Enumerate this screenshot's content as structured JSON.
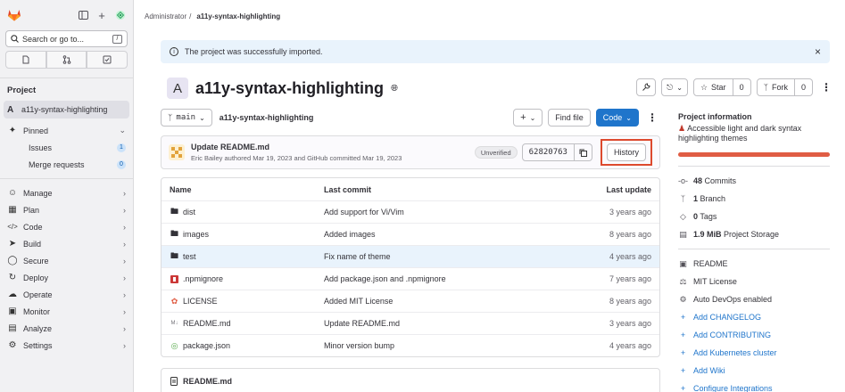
{
  "sidebar": {
    "search_label": "Search or go to...",
    "search_kbd": "/",
    "section_title": "Project",
    "project_avatar": "A",
    "project_name": "a11y-syntax-highlighting",
    "pinned": {
      "label": "Pinned",
      "items": [
        {
          "label": "Issues",
          "count": "1"
        },
        {
          "label": "Merge requests",
          "count": "0"
        }
      ]
    },
    "nav": [
      {
        "label": "Manage",
        "icon": "users-icon"
      },
      {
        "label": "Plan",
        "icon": "calendar-icon"
      },
      {
        "label": "Code",
        "icon": "code-icon"
      },
      {
        "label": "Build",
        "icon": "rocket-icon"
      },
      {
        "label": "Secure",
        "icon": "shield-icon"
      },
      {
        "label": "Deploy",
        "icon": "deploy-icon"
      },
      {
        "label": "Operate",
        "icon": "cloud-icon"
      },
      {
        "label": "Monitor",
        "icon": "monitor-icon"
      },
      {
        "label": "Analyze",
        "icon": "chart-icon"
      },
      {
        "label": "Settings",
        "icon": "gear-icon"
      }
    ]
  },
  "breadcrumb": {
    "parent": "Administrator",
    "separator": "/",
    "current": "a11y-syntax-highlighting"
  },
  "alert": {
    "message": "The project was successfully imported."
  },
  "project": {
    "avatar": "A",
    "title": "a11y-syntax-highlighting",
    "star_label": "Star",
    "star_count": "0",
    "fork_label": "Fork",
    "fork_count": "0"
  },
  "branch_bar": {
    "branch": "main",
    "path": "a11y-syntax-highlighting",
    "plus_label": "+",
    "find_file": "Find file",
    "code_label": "Code"
  },
  "last_commit": {
    "title": "Update README.md",
    "meta": "Eric Bailey authored Mar 19, 2023 and GitHub committed Mar 19, 2023",
    "status": "Unverified",
    "sha": "62820763",
    "history_label": "History"
  },
  "files": {
    "headers": {
      "name": "Name",
      "commit": "Last commit",
      "update": "Last update"
    },
    "rows": [
      {
        "name": "dist",
        "icon": "folder-icon",
        "commit": "Add support for Vi/Vim",
        "update": "3 years ago"
      },
      {
        "name": "images",
        "icon": "folder-icon",
        "commit": "Added images",
        "update": "8 years ago"
      },
      {
        "name": "test",
        "icon": "folder-icon",
        "commit": "Fix name of theme",
        "update": "4 years ago"
      },
      {
        "name": ".npmignore",
        "icon": "npm-icon",
        "commit": "Add package.json and .npmignore",
        "update": "7 years ago"
      },
      {
        "name": "LICENSE",
        "icon": "license-icon",
        "commit": "Added MIT License",
        "update": "8 years ago"
      },
      {
        "name": "README.md",
        "icon": "markdown-icon",
        "commit": "Update README.md",
        "update": "3 years ago"
      },
      {
        "name": "package.json",
        "icon": "package-icon",
        "commit": "Minor version bump",
        "update": "4 years ago"
      }
    ]
  },
  "readme_header": "README.md",
  "info": {
    "title": "Project information",
    "description": "Accessible light and dark syntax highlighting themes",
    "language_color": "#e05d44",
    "stats": [
      {
        "icon": "commit-icon",
        "bold": "48",
        "text": "Commits"
      },
      {
        "icon": "branch-icon",
        "bold": "1",
        "text": "Branch"
      },
      {
        "icon": "tag-icon",
        "bold": "0",
        "text": "Tags"
      },
      {
        "icon": "storage-icon",
        "bold": "1.9 MiB",
        "text": "Project Storage"
      }
    ],
    "docs": [
      {
        "icon": "readme-icon",
        "text": "README"
      },
      {
        "icon": "scale-icon",
        "text": "MIT License"
      },
      {
        "icon": "devops-icon",
        "text": "Auto DevOps enabled"
      }
    ],
    "links": [
      {
        "text": "Add CHANGELOG"
      },
      {
        "text": "Add CONTRIBUTING"
      },
      {
        "text": "Add Kubernetes cluster"
      },
      {
        "text": "Add Wiki"
      },
      {
        "text": "Configure Integrations"
      }
    ]
  }
}
